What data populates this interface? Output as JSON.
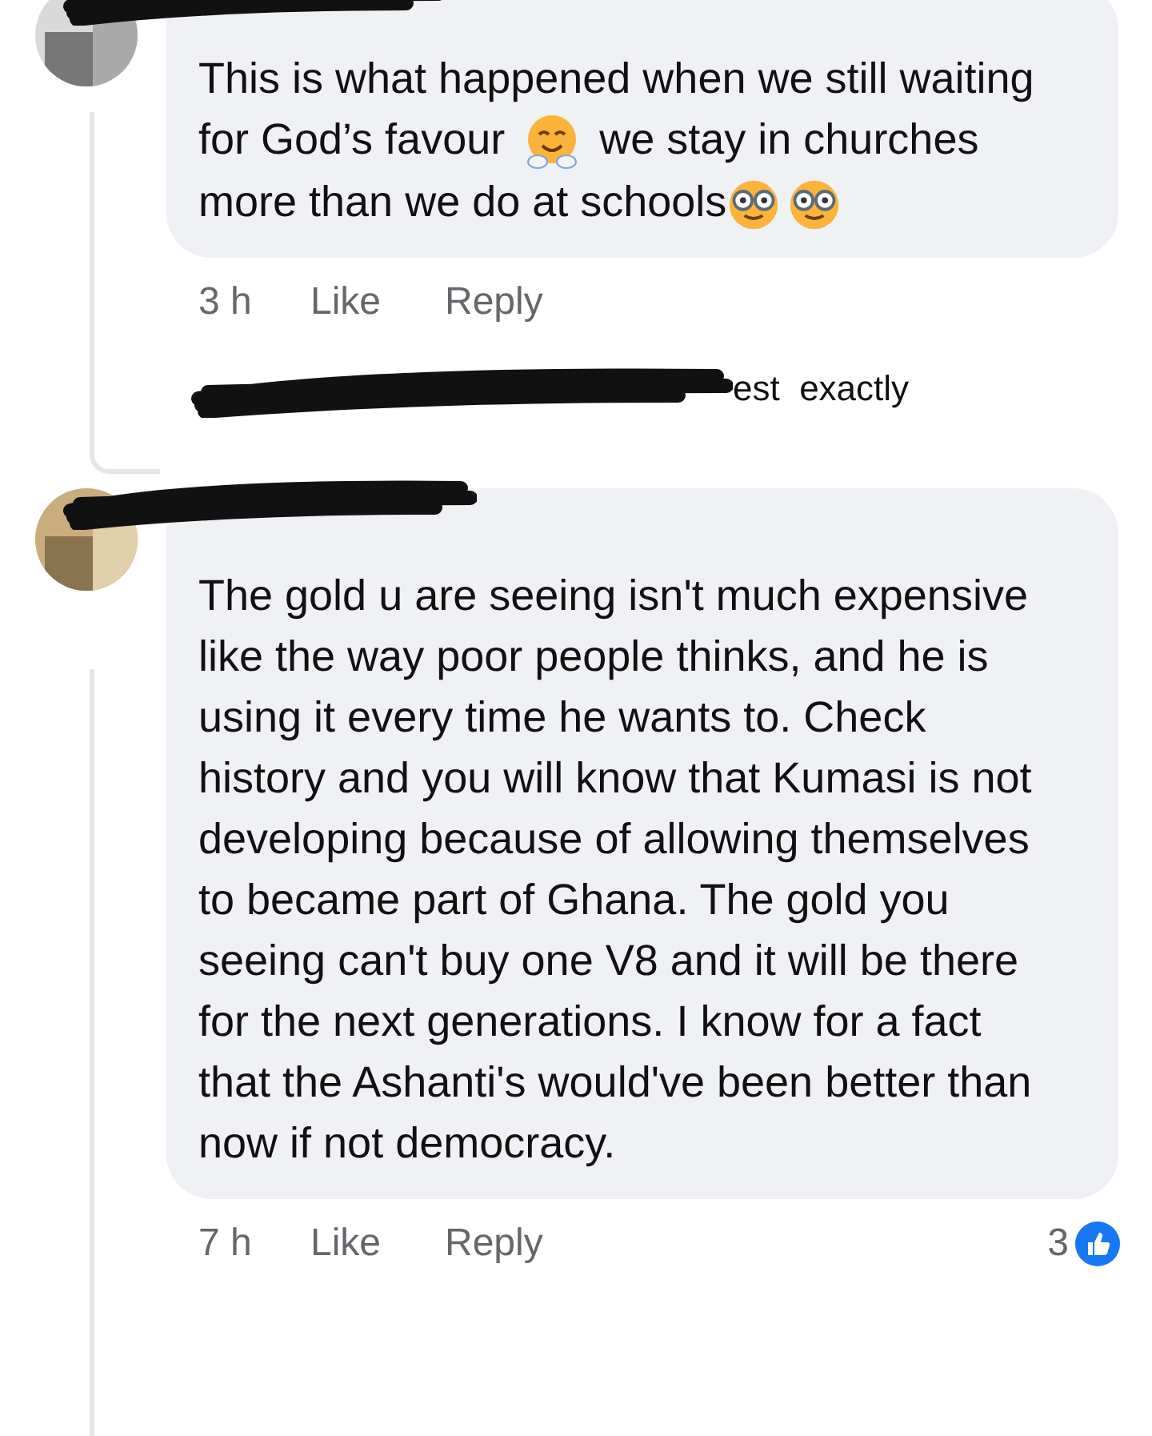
{
  "comments": [
    {
      "segments": [
        {
          "kind": "text",
          "text": "This is what happened when we still waiting for God’s favour "
        },
        {
          "kind": "hug-emoji"
        },
        {
          "kind": "text",
          "text": " we stay in churches more than we do at schools"
        },
        {
          "kind": "nerd-emoji"
        },
        {
          "kind": "nerd-emoji"
        }
      ],
      "time": "3 h",
      "like": "Like",
      "reply": "Reply",
      "reply_preview": "est  exactly"
    },
    {
      "segments": [
        {
          "kind": "text",
          "text": "The gold u are seeing isn't much expensive like the way poor people thinks, and he is using it every time he wants to. Check history and you will know that Kumasi is not developing because of allowing themselves to became part of Ghana. The gold you seeing can't buy one V8 and it will be there for the next generations. I know for a fact that the Ashanti's would've been better than now if not democracy."
        }
      ],
      "time": "7 h",
      "like": "Like",
      "reply": "Reply",
      "reaction_count": "3"
    }
  ]
}
